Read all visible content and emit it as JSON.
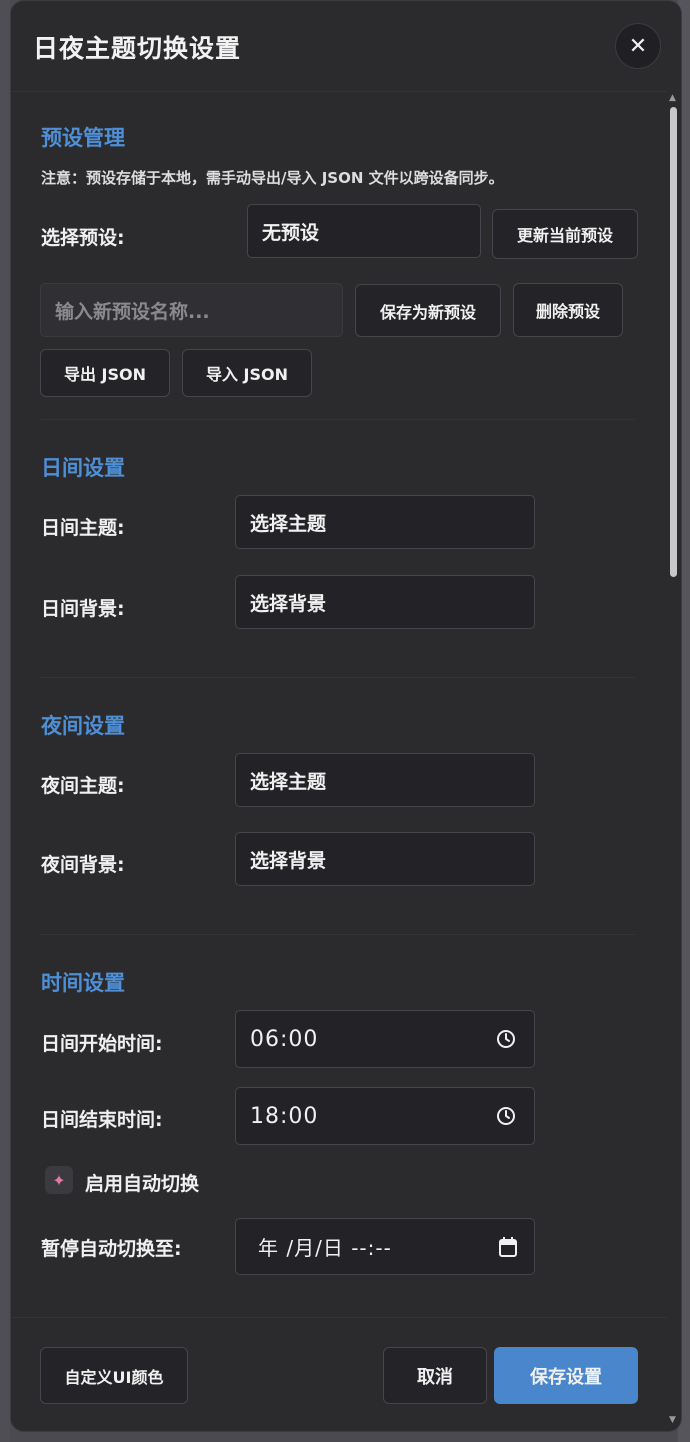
{
  "dialog": {
    "title": "日夜主题切换设置",
    "close_label": "✕"
  },
  "presets": {
    "section_title": "预设管理",
    "note": "注意：预设存储于本地，需手动导出/导入 JSON 文件以跨设备同步。",
    "select_label": "选择预设:",
    "select_value": "无预设",
    "update_button": "更新当前预设",
    "name_placeholder": "输入新预设名称...",
    "save_new_button": "保存为新预设",
    "delete_button": "删除预设",
    "export_button": "导出 JSON",
    "import_button": "导入 JSON"
  },
  "day": {
    "section_title": "日间设置",
    "theme_label": "日间主题:",
    "theme_value": "选择主题",
    "background_label": "日间背景:",
    "background_value": "选择背景"
  },
  "night": {
    "section_title": "夜间设置",
    "theme_label": "夜间主题:",
    "theme_value": "选择主题",
    "background_label": "夜间背景:",
    "background_value": "选择背景"
  },
  "time": {
    "section_title": "时间设置",
    "day_start_label": "日间开始时间:",
    "day_start_value": "06:00",
    "day_end_label": "日间结束时间:",
    "day_end_value": "18:00",
    "auto_switch_label": "启用自动切换",
    "auto_switch_icon": "sparkle-icon",
    "pause_label": "暂停自动切换至:",
    "pause_value": "年 /月/日 --:--"
  },
  "footer": {
    "custom_ui_color_button": "自定义UI颜色",
    "cancel_button": "取消",
    "save_button": "保存设置"
  },
  "colors": {
    "accent": "#4e8fd6",
    "primary_button": "#4a86cc",
    "dialog_bg": "#2b2b2e"
  }
}
